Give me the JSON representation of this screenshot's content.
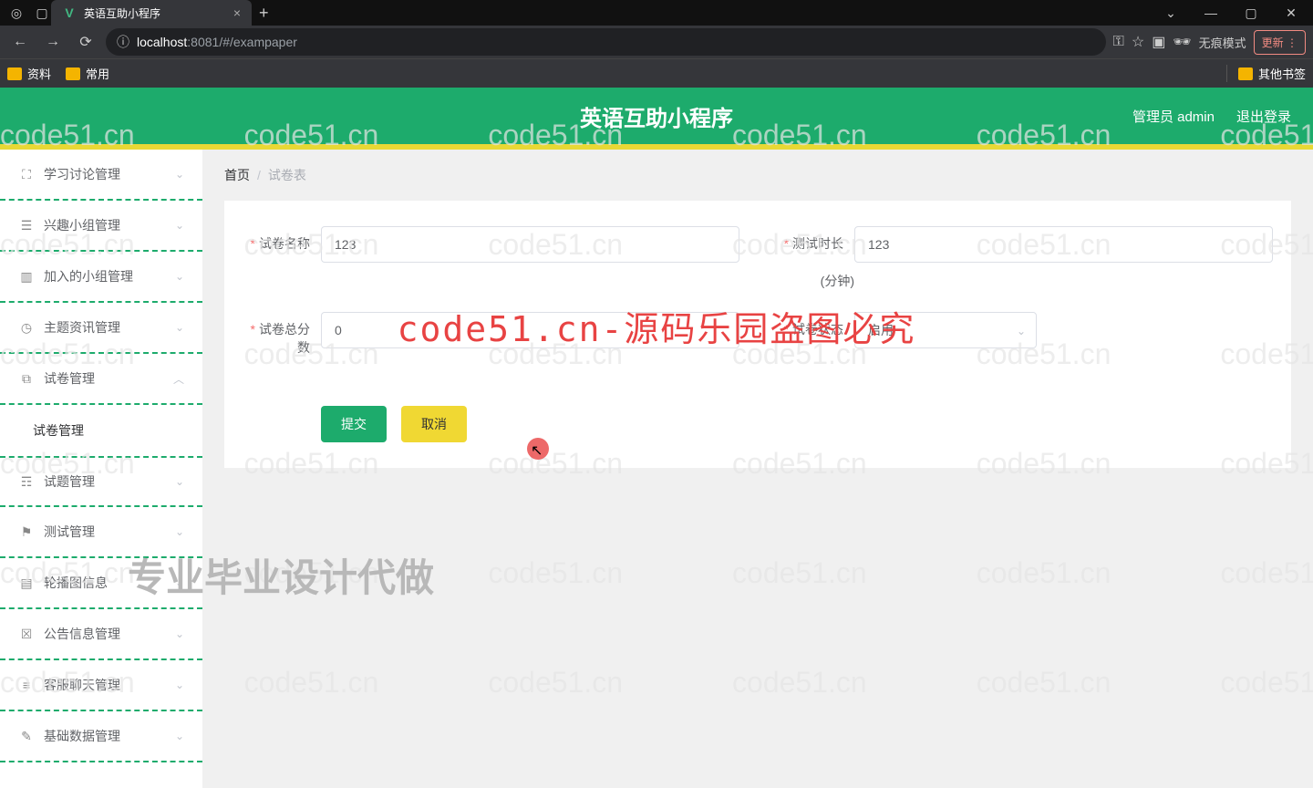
{
  "browser": {
    "tab_title": "英语互助小程序",
    "url_host": "localhost",
    "url_port": ":8081",
    "url_path": "/#/exampaper",
    "incognito": "无痕模式",
    "update": "更新",
    "bookmarks": {
      "b1": "资料",
      "b2": "常用",
      "others": "其他书签"
    }
  },
  "app": {
    "title": "英语互助小程序",
    "header": {
      "admin": "管理员 admin",
      "logout": "退出登录"
    }
  },
  "sidebar": {
    "items": [
      {
        "label": "学习讨论管理"
      },
      {
        "label": "兴趣小组管理"
      },
      {
        "label": "加入的小组管理"
      },
      {
        "label": "主题资讯管理"
      },
      {
        "label": "试卷管理"
      },
      {
        "label": "试卷管理"
      },
      {
        "label": "试题管理"
      },
      {
        "label": "测试管理"
      },
      {
        "label": "轮播图信息"
      },
      {
        "label": "公告信息管理"
      },
      {
        "label": "客服聊天管理"
      },
      {
        "label": "基础数据管理"
      }
    ]
  },
  "breadcrumb": {
    "home": "首页",
    "current": "试卷表"
  },
  "form": {
    "paper_name": {
      "label": "试卷名称",
      "value": "123"
    },
    "duration": {
      "label": "测试时长",
      "value": "123",
      "unit": "(分钟)"
    },
    "total_score": {
      "label": "试卷总分数",
      "value": "0"
    },
    "status": {
      "label": "试卷状态",
      "value": "启用"
    },
    "submit": "提交",
    "cancel": "取消"
  },
  "watermark": {
    "text": "code51.cn",
    "big": "code51.cn-源码乐园盗图必究",
    "big2": "专业毕业设计代做"
  }
}
